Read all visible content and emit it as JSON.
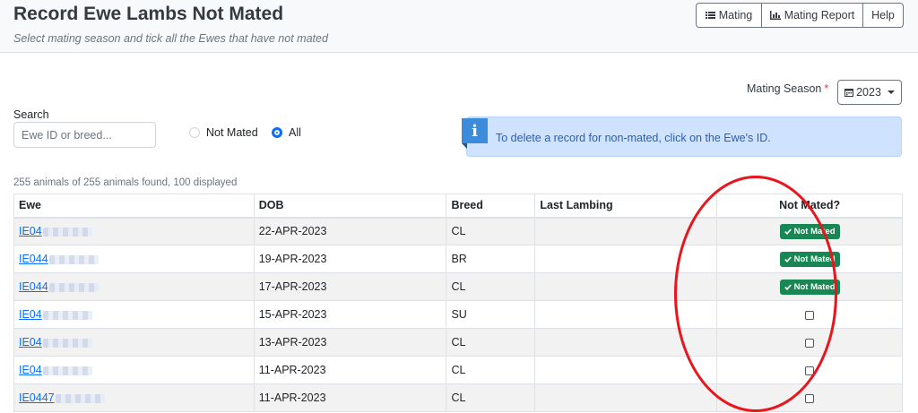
{
  "header": {
    "title": "Record Ewe Lambs Not Mated",
    "subtitle": "Select mating season and tick all the Ewes that have not mated",
    "buttons": {
      "mating": "Mating",
      "report": "Mating Report",
      "help": "Help"
    }
  },
  "season": {
    "label": "Mating Season",
    "required_mark": "*",
    "value": "2023"
  },
  "search": {
    "label": "Search",
    "placeholder": "Ewe ID or breed..."
  },
  "filter": {
    "not_mated": "Not Mated",
    "all": "All",
    "selected": "All"
  },
  "info": {
    "text": "To delete a record for non-mated, click on the Ewe's ID."
  },
  "found_text": "255 animals of 255 animals found, 100 displayed",
  "table": {
    "headers": {
      "ewe": "Ewe",
      "dob": "DOB",
      "breed": "Breed",
      "last_lambing": "Last Lambing",
      "not_mated": "Not Mated?"
    },
    "badge_label": "Not Mated",
    "rows": [
      {
        "ewe": "IE04",
        "dob": "22-APR-2023",
        "breed": "CL",
        "last_lambing": "",
        "not_mated": true
      },
      {
        "ewe": "IE044",
        "dob": "19-APR-2023",
        "breed": "BR",
        "last_lambing": "",
        "not_mated": true
      },
      {
        "ewe": "IE044",
        "dob": "17-APR-2023",
        "breed": "CL",
        "last_lambing": "",
        "not_mated": true
      },
      {
        "ewe": "IE04",
        "dob": "15-APR-2023",
        "breed": "SU",
        "last_lambing": "",
        "not_mated": false
      },
      {
        "ewe": "IE04",
        "dob": "13-APR-2023",
        "breed": "CL",
        "last_lambing": "",
        "not_mated": false
      },
      {
        "ewe": "IE04",
        "dob": "11-APR-2023",
        "breed": "CL",
        "last_lambing": "",
        "not_mated": false
      },
      {
        "ewe": "IE0447",
        "dob": "11-APR-2023",
        "breed": "CL",
        "last_lambing": "",
        "not_mated": false
      }
    ]
  },
  "colors": {
    "badge": "#198754",
    "circle": "#e8161c",
    "info_bg": "#cfe2ff",
    "link": "#0d6efd"
  },
  "icons": {
    "mating": "list-icon",
    "report": "bar-chart-icon",
    "season": "calendar-icon",
    "info": "info-icon",
    "badge": "check-icon"
  }
}
